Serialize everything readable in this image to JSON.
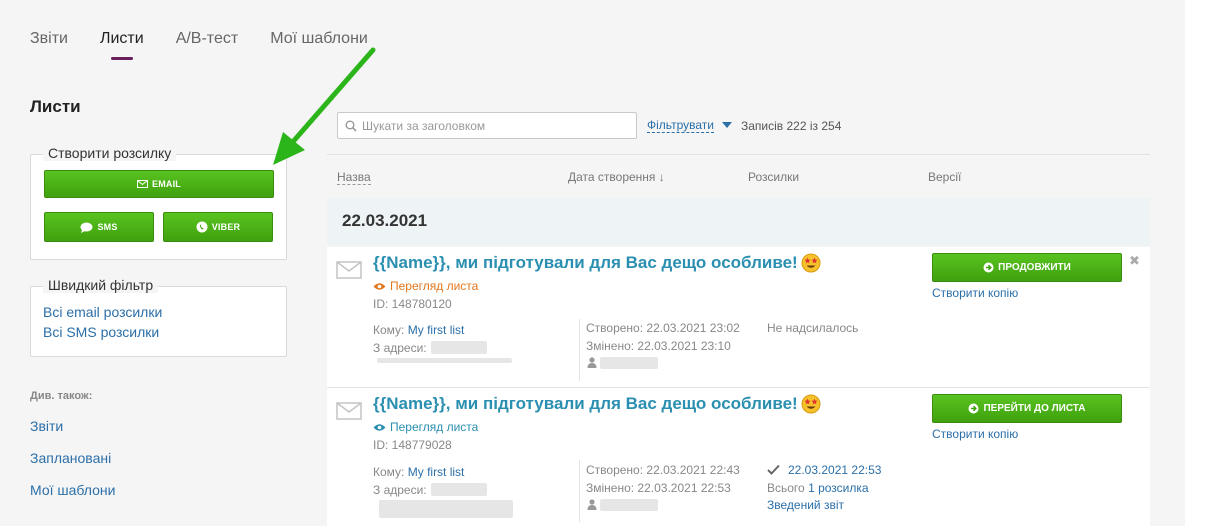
{
  "tabs": [
    {
      "label": "Звіти"
    },
    {
      "label": "Листи",
      "active": true
    },
    {
      "label": "A/B-тест"
    },
    {
      "label": "Мої шаблони"
    }
  ],
  "sidebar": {
    "title": "Листи",
    "create": {
      "legend": "Створити розсилку",
      "email_label": "EMAIL",
      "sms_label": "SMS",
      "viber_label": "VIBER"
    },
    "quick_filter": {
      "legend": "Швидкий фільтр",
      "links": [
        "Всі email розсилки",
        "Всі SMS розсилки"
      ]
    },
    "see_also": "Див. також:",
    "links": [
      "Звіти",
      "Заплановані",
      "Мої шаблони"
    ]
  },
  "toolbar": {
    "search_placeholder": "Шукати за заголовком",
    "filter_label": "Фільтрувати",
    "records_text": "Записів 222 із 254"
  },
  "table": {
    "headers": {
      "name": "Назва",
      "created": "Дата створення ↓",
      "mailings": "Розсилки",
      "versions": "Версії"
    },
    "group_date": "22.03.2021",
    "rows": [
      {
        "subject": "{{Name}}, ми підготували для Вас дещо особливе!",
        "preview": "Перегляд листа",
        "id": "ID: 148780120",
        "to_label": "Кому:",
        "to_value": "My first list",
        "from_label": "З адреси:",
        "created": "Створено: 22.03.2021 23:02",
        "changed": "Змінено: 22.03.2021 23:10",
        "status": "Не надсилалось",
        "action": "ПРОДОВЖИТИ",
        "copy": "Створити копію"
      },
      {
        "subject": "{{Name}}, ми підготували для Вас дещо особливе!",
        "preview": "Перегляд листа",
        "id": "ID: 148779028",
        "to_label": "Кому:",
        "to_value": "My first list",
        "from_label": "З адреси:",
        "created": "Створено: 22.03.2021 22:43",
        "changed": "Змінено: 22.03.2021 22:53",
        "sent_date": "22.03.2021 22:53",
        "total_prefix": "Всього",
        "total_link": "1 розсилка",
        "report": "Зведений звіт",
        "action": "ПЕРЕЙТИ ДО ЛИСТА",
        "copy": "Створити копію"
      }
    ]
  },
  "colors": {
    "accent_green": "#4fb81a",
    "link_blue": "#2b6fa8",
    "subject_blue": "#2a8fb0",
    "tab_underline": "#6a1f5c",
    "arrow_green": "#2bb51a",
    "preview_orange": "#e2771c"
  }
}
